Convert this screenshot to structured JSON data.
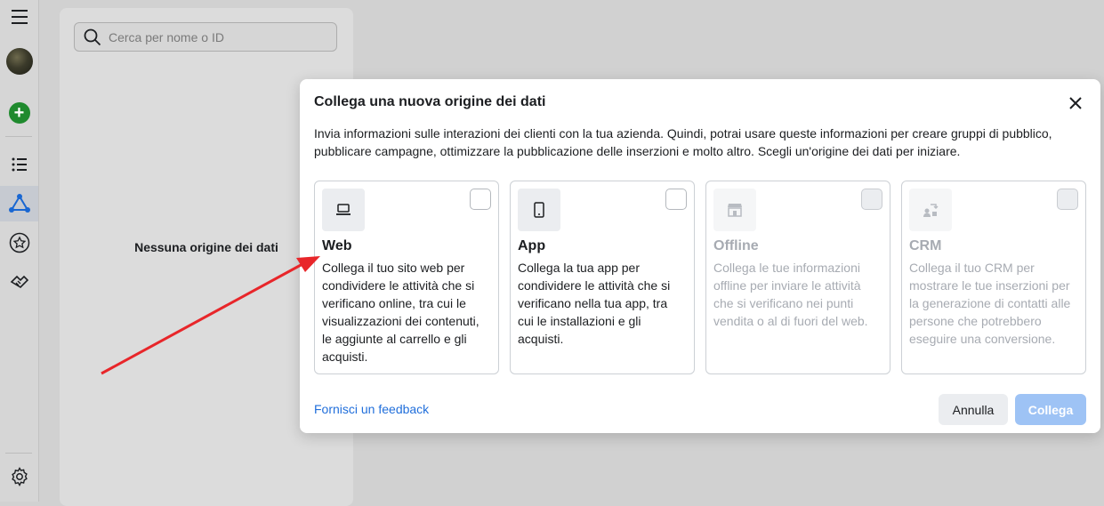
{
  "sidebar": {
    "icons": [
      "menu-icon",
      "avatar",
      "add-icon",
      "list-icon",
      "data-sources-icon",
      "star-icon",
      "handshake-icon",
      "settings-icon"
    ]
  },
  "panel": {
    "search_placeholder": "Cerca per nome o ID",
    "empty_text": "Nessuna origine dei dati"
  },
  "modal": {
    "title": "Collega una nuova origine dei dati",
    "description": "Invia informazioni sulle interazioni dei clienti con la tua azienda. Quindi, potrai usare queste informazioni per creare gruppi di pubblico, pubblicare campagne, ottimizzare la pubblicazione delle inserzioni e molto altro. Scegli un'origine dei dati per iniziare.",
    "cards": [
      {
        "title": "Web",
        "description": "Collega il tuo sito web per condividere le attività che si verificano online, tra cui le visualizzazioni dei contenuti, le aggiunte al carrello e gli acquisti.",
        "icon": "laptop-icon",
        "enabled": true
      },
      {
        "title": "App",
        "description": "Collega la tua app per condividere le attività che si verificano nella tua app, tra cui le installazioni e gli acquisti.",
        "icon": "phone-icon",
        "enabled": true
      },
      {
        "title": "Offline",
        "description": "Collega le tue informazioni offline per inviare le attività che si verificano nei punti vendita o al di fuori del web.",
        "icon": "store-icon",
        "enabled": false
      },
      {
        "title": "CRM",
        "description": "Collega il tuo CRM per mostrare le tue inserzioni per la generazione di contatti alle persone che potrebbero eseguire una conversione.",
        "icon": "crm-icon",
        "enabled": false
      }
    ],
    "feedback_link": "Fornisci un feedback",
    "cancel_label": "Annulla",
    "connect_label": "Collega"
  },
  "colors": {
    "accent": "#216fdb",
    "connect_disabled": "#9ec3f5",
    "annotation_arrow": "#e8262a"
  }
}
